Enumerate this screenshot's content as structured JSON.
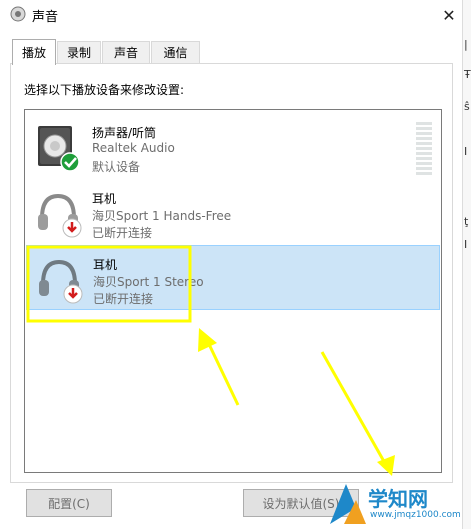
{
  "window": {
    "title": "声音",
    "close_glyph": "✕"
  },
  "tabs": [
    {
      "label": "播放",
      "active": true
    },
    {
      "label": "录制",
      "active": false
    },
    {
      "label": "声音",
      "active": false
    },
    {
      "label": "通信",
      "active": false
    }
  ],
  "instruction": "选择以下播放设备来修改设置:",
  "devices": [
    {
      "name": "扬声器/听筒",
      "sub": "Realtek Audio",
      "status": "默认设备",
      "icon": "speaker-icon",
      "badge": "check-badge-icon",
      "selected": false
    },
    {
      "name": "耳机",
      "sub": "海贝Sport 1 Hands-Free",
      "status": "已断开连接",
      "icon": "headphones-icon",
      "badge": "disconnected-badge-icon",
      "selected": false
    },
    {
      "name": "耳机",
      "sub": "海贝Sport 1 Stereo",
      "status": "已断开连接",
      "icon": "headphones-icon",
      "badge": "disconnected-badge-icon",
      "selected": true
    }
  ],
  "buttons": {
    "configure": "配置(C)",
    "set_default": "设为默认值(S)"
  },
  "watermark": {
    "text": "学知网",
    "url": "www.jmqz1000.com"
  },
  "colors": {
    "selection": "#cce4f7",
    "annotation": "#ffff00",
    "accent": "#1e88c9"
  }
}
